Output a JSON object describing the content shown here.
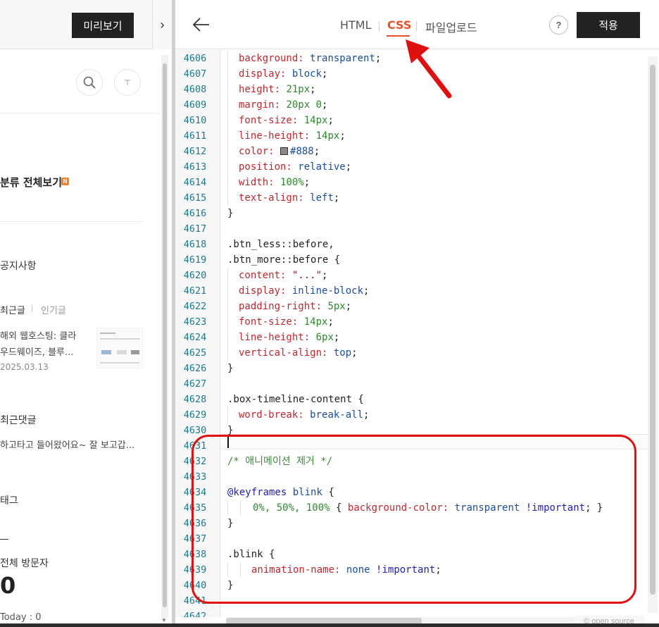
{
  "left_panel": {
    "preview_button": "미리보기",
    "category_title": "분류 전체보기",
    "new_badge": "N",
    "notice": "공지사항",
    "tabs": {
      "recent": "최근글",
      "popular": "인기글"
    },
    "recent_post": {
      "line1": "해외 웹호스팅: 클라",
      "line2": "우드웨이즈, 블루...",
      "date": "2025.03.13"
    },
    "comments_title": "최근댓글",
    "comment_text": "하고타고 들어왔어요~ 잘 보고갑...",
    "tag_title": "태그",
    "visitors_label": "전체 방문자",
    "visitors_count": "0",
    "today_label": "Today : 0"
  },
  "editor": {
    "tabs": {
      "html": "HTML",
      "css": "CSS",
      "upload": "파일업로드"
    },
    "active_tab": "CSS",
    "help_label": "?",
    "apply_button": "적용",
    "open_source_label": "© open source",
    "line_numbers": [
      "4606",
      "4607",
      "4608",
      "4609",
      "4610",
      "4611",
      "4612",
      "4613",
      "4614",
      "4615",
      "4616",
      "4617",
      "4618",
      "4619",
      "4620",
      "4621",
      "4622",
      "4623",
      "4624",
      "4625",
      "4626",
      "4627",
      "4628",
      "4629",
      "4630",
      "4631",
      "4632",
      "4633",
      "4634",
      "4635",
      "4636",
      "4637",
      "4638",
      "4639",
      "4640",
      "4641",
      "4642"
    ],
    "code": {
      "l4606": {
        "prop": "background:",
        "val": "transparent",
        "end": ";"
      },
      "l4607": {
        "prop": "display:",
        "val": "block",
        "end": ";"
      },
      "l4608": {
        "prop": "height:",
        "val": "21px",
        "end": ";"
      },
      "l4609": {
        "prop": "margin:",
        "val": "20px 0",
        "end": ";"
      },
      "l4610": {
        "prop": "font-size:",
        "val": "14px",
        "end": ";"
      },
      "l4611": {
        "prop": "line-height:",
        "val": "14px",
        "end": ";"
      },
      "l4612": {
        "prop": "color:",
        "val": "#888",
        "end": ";"
      },
      "l4613": {
        "prop": "position:",
        "val": "relative",
        "end": ";"
      },
      "l4614": {
        "prop": "width:",
        "val": "100%",
        "end": ";"
      },
      "l4615": {
        "prop": "text-align:",
        "val": "left",
        "end": ";"
      },
      "l4616": "}",
      "l4618": ".btn_less::before,",
      "l4619": ".btn_more::before {",
      "l4620": {
        "prop": "content:",
        "val": "\"...\"",
        "end": ";"
      },
      "l4621": {
        "prop": "display:",
        "val": "inline-block",
        "end": ";"
      },
      "l4622": {
        "prop": "padding-right:",
        "val": "5px",
        "end": ";"
      },
      "l4623": {
        "prop": "font-size:",
        "val": "14px",
        "end": ";"
      },
      "l4624": {
        "prop": "line-height:",
        "val": "6px",
        "end": ";"
      },
      "l4625": {
        "prop": "vertical-align:",
        "val": "top",
        "end": ";"
      },
      "l4626": "}",
      "l4628": ".box-timeline-content {",
      "l4629": {
        "prop": "word-break:",
        "val": "break-all",
        "end": ";"
      },
      "l4630": "}",
      "l4632": "/* 애니메이션 제거 */",
      "l4634": {
        "at": "@keyframes",
        "name": "blink",
        "brace": "{"
      },
      "l4635": {
        "sel": "0%, 50%, 100%",
        "open": "{",
        "prop": "background-color:",
        "val": "transparent",
        "imp": "!important",
        "close": "; }"
      },
      "l4636": "}",
      "l4638": ".blink {",
      "l4639": {
        "prop": "animation-name:",
        "val": "none",
        "imp": "!important",
        "end": ";"
      },
      "l4640": "}"
    }
  },
  "colors": {
    "accent_css_tab": "#e8522a",
    "dark_button": "#222222",
    "annotation_red": "#e01010",
    "line_number": "#1a7a8c",
    "css_property": "#c1272d",
    "css_value": "#1a4fa0",
    "css_comment": "#3a8a3a"
  },
  "icons": {
    "back": "arrow-left-icon",
    "collapse": "chevron-right-icon",
    "search": "search-icon",
    "font": "text-size-icon",
    "help": "help-icon"
  }
}
